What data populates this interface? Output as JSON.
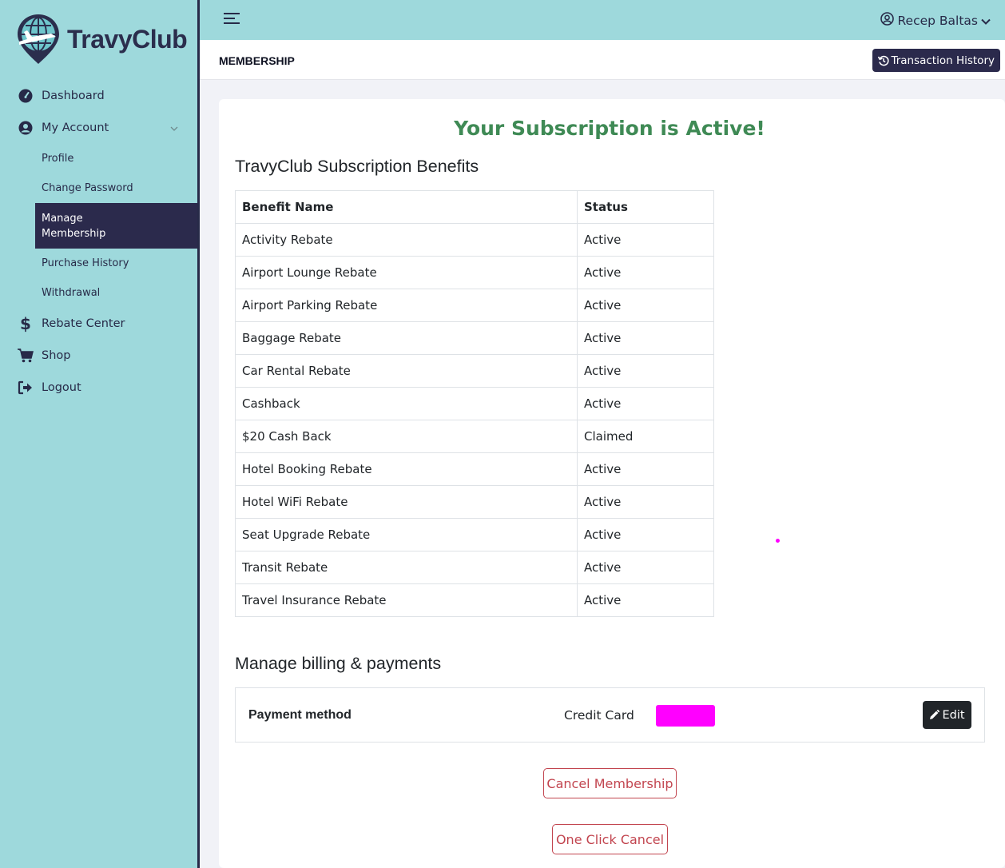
{
  "brand": {
    "name": "TravyClub",
    "logo_icon": "globe-plane-pin-icon"
  },
  "sidebar": {
    "items": [
      {
        "label": "Dashboard",
        "icon": "dashboard-gauge-icon"
      },
      {
        "label": "My Account",
        "icon": "user-circle-icon"
      },
      {
        "label": "Rebate Center",
        "icon": "dollar-icon"
      },
      {
        "label": "Shop",
        "icon": "cart-icon"
      },
      {
        "label": "Logout",
        "icon": "logout-icon"
      }
    ],
    "account_sub": [
      {
        "label": "Profile"
      },
      {
        "label": "Change Password"
      },
      {
        "label": "Manage Membership"
      },
      {
        "label": "Purchase History"
      },
      {
        "label": "Withdrawal"
      }
    ]
  },
  "header": {
    "user_name": "Recep Baltas"
  },
  "subheader": {
    "title": "MEMBERSHIP",
    "history_button": "Transaction History"
  },
  "main": {
    "headline": "Your Subscription is Active!",
    "benefits_title": "TravyClub Subscription Benefits",
    "table": {
      "columns": [
        "Benefit Name",
        "Status"
      ],
      "rows": [
        [
          "Activity Rebate",
          "Active"
        ],
        [
          "Airport Lounge Rebate",
          "Active"
        ],
        [
          "Airport Parking Rebate",
          "Active"
        ],
        [
          "Baggage Rebate",
          "Active"
        ],
        [
          "Car Rental Rebate",
          "Active"
        ],
        [
          "Cashback",
          "Active"
        ],
        [
          "$20 Cash Back",
          "Claimed"
        ],
        [
          "Hotel Booking Rebate",
          "Active"
        ],
        [
          "Hotel WiFi Rebate",
          "Active"
        ],
        [
          "Seat Upgrade Rebate",
          "Active"
        ],
        [
          "Transit Rebate",
          "Active"
        ],
        [
          "Travel Insurance Rebate",
          "Active"
        ]
      ]
    },
    "billing_title": "Manage billing & payments",
    "payment": {
      "label": "Payment method",
      "value": "Credit Card",
      "edit_label": "Edit"
    },
    "cancel_label": "Cancel Membership",
    "one_click_label": "One Click Cancel"
  },
  "colors": {
    "sidebar_bg": "#9ed9dc",
    "accent_dark": "#2b2a4c",
    "success": "#3f8a55",
    "danger": "#c2454f"
  }
}
